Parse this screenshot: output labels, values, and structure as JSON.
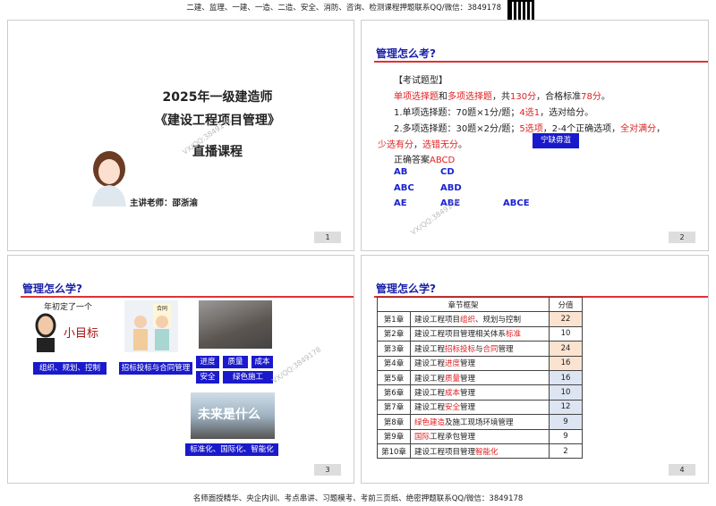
{
  "header": {
    "text": "二建、监理、一建、一造、二造、安全、消防、咨询、检测课程押题联系QQ/微信：3849178"
  },
  "footer": {
    "text": "名师面授精华、央企内训、考点串讲、习题模考、考前三页纸、绝密押题联系QQ/微信：3849178"
  },
  "watermark": "VX/QQ:3849178",
  "slide1": {
    "line1": "2025年一级建造师",
    "line2": "《建设工程项目管理》",
    "line3": "直播课程",
    "teacher": "主讲老师：邵浙渝",
    "page": "1"
  },
  "slide2": {
    "title": "管理怎么考?",
    "type_label": "【考试题型】",
    "l1": [
      "单项选择题",
      "和",
      "多项选择题",
      "，共",
      "130分",
      "，合格标准",
      "78分",
      "。"
    ],
    "l2": [
      "1.单项选择题：70题×1分/题；",
      "4选1",
      "，选对给分。"
    ],
    "l3": [
      "2.多项选择题：30题×2分/题；",
      "5选项",
      "，2-4个正确选项，",
      "全对满分",
      "，"
    ],
    "l4": [
      "少选有分",
      "，",
      "选错无分",
      "。"
    ],
    "button": "宁缺毋滥",
    "answer": [
      "正确答案",
      "ABCD"
    ],
    "options": [
      "AB",
      "CD",
      "ABC",
      "ABD",
      "AE",
      "ABE",
      "ABCE"
    ],
    "page": "2"
  },
  "slide3": {
    "title": "管理怎么学?",
    "img1_caption": "年初定了一个",
    "img1_text": "小目标",
    "img2_text": "合同",
    "img4_text": "未来是什么",
    "tags": [
      "组织、规划、控制",
      "招标投标与合同管理",
      "进度",
      "质量",
      "成本",
      "安全",
      "绿色施工",
      "标准化、国际化、智能化"
    ],
    "page": "3"
  },
  "slide4": {
    "title": "管理怎么学?",
    "headers": [
      "章节框架",
      "分值"
    ],
    "rows": [
      {
        "ch": "第1章",
        "parts": [
          "建设工程项目",
          "组织",
          "、规划与控制"
        ],
        "score": "22",
        "bg": "#fbe3d0"
      },
      {
        "ch": "第2章",
        "parts": [
          "建设工程项目管理相关体系",
          "标准",
          ""
        ],
        "score": "10",
        "bg": "#fff"
      },
      {
        "ch": "第3章",
        "parts": [
          "建设工程",
          "招标投标",
          "与",
          "合同",
          "管理"
        ],
        "score": "24",
        "bg": "#fbe3d0"
      },
      {
        "ch": "第4章",
        "parts": [
          "建设工程",
          "进度",
          "管理"
        ],
        "score": "16",
        "bg": "#fbe3d0"
      },
      {
        "ch": "第5章",
        "parts": [
          "建设工程",
          "质量",
          "管理"
        ],
        "score": "16",
        "bg": "#dde4f2"
      },
      {
        "ch": "第6章",
        "parts": [
          "建设工程",
          "成本",
          "管理"
        ],
        "score": "10",
        "bg": "#dde4f2"
      },
      {
        "ch": "第7章",
        "parts": [
          "建设工程",
          "安全",
          "管理"
        ],
        "score": "12",
        "bg": "#dde4f2"
      },
      {
        "ch": "第8章",
        "parts": [
          "",
          "绿色建造",
          "及施工现场环境管理"
        ],
        "score": "9",
        "bg": "#dde4f2"
      },
      {
        "ch": "第9章",
        "parts": [
          "",
          "国际",
          "工程承包管理"
        ],
        "score": "9",
        "bg": "#fff"
      },
      {
        "ch": "第10章",
        "parts": [
          "建设工程项目管理",
          "智能化",
          ""
        ],
        "score": "2",
        "bg": "#fff"
      }
    ],
    "page": "4"
  }
}
